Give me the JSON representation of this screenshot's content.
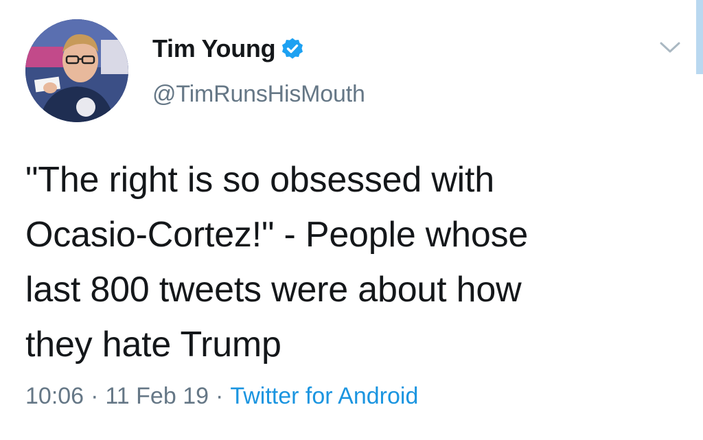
{
  "author": {
    "display_name": "Tim Young",
    "handle": "@TimRunsHisMouth",
    "verified": true
  },
  "tweet": {
    "text": "\"The right is so obsessed with\nOcasio-Cortez!\" - People whose\nlast 800 tweets were about how\nthey hate Trump"
  },
  "meta": {
    "time": "10:06",
    "separator": "·",
    "date": "11 Feb 19",
    "source": "Twitter for Android"
  },
  "colors": {
    "verified_blue": "#1da1f2",
    "link_blue": "#1b95e0",
    "muted_gray": "#657786",
    "text_dark": "#14171a"
  },
  "icons": {
    "menu": "chevron-down-icon",
    "verified": "verified-badge-icon"
  }
}
